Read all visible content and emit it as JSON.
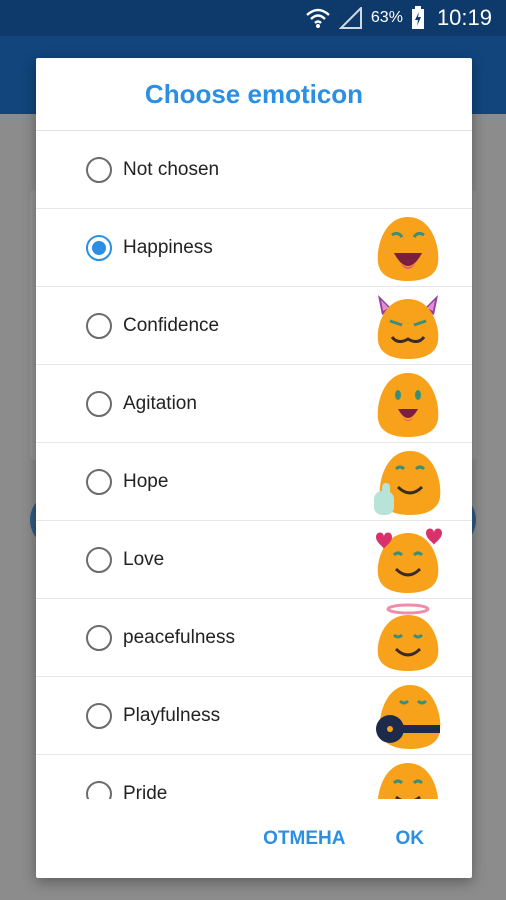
{
  "status_bar": {
    "battery_percent": "63%",
    "time": "10:19",
    "icons": [
      "wifi-icon",
      "cell-signal-icon",
      "battery-charging-icon"
    ]
  },
  "dialog": {
    "title": "Choose emoticon",
    "options": [
      {
        "label": "Not chosen",
        "checked": false,
        "emoji": null
      },
      {
        "label": "Happiness",
        "checked": true,
        "emoji": "happiness-emoji-icon"
      },
      {
        "label": "Confidence",
        "checked": false,
        "emoji": "confidence-emoji-icon"
      },
      {
        "label": "Agitation",
        "checked": false,
        "emoji": "agitation-emoji-icon"
      },
      {
        "label": "Hope",
        "checked": false,
        "emoji": "hope-emoji-icon"
      },
      {
        "label": "Love",
        "checked": false,
        "emoji": "love-emoji-icon"
      },
      {
        "label": "peacefulness",
        "checked": false,
        "emoji": "peacefulness-emoji-icon"
      },
      {
        "label": "Playfulness",
        "checked": false,
        "emoji": "playfulness-emoji-icon"
      },
      {
        "label": "Pride",
        "checked": false,
        "emoji": "pride-emoji-icon"
      }
    ],
    "cancel_label": "ОТМЕНА",
    "ok_label": "OK"
  },
  "colors": {
    "accent": "#2b8fe3",
    "status_bar": "#0d3a6a",
    "app_bar": "#11457c",
    "emoji_body": "#f7a21a"
  }
}
